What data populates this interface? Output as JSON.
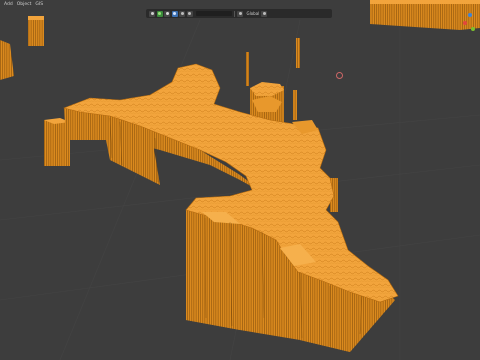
{
  "menu": [
    "Add",
    "Object",
    "GIS"
  ],
  "toolbar": {
    "mode_label": "Global",
    "search_placeholder": ""
  },
  "colors": {
    "background": "#3d3d3d",
    "mesh_top": "#f0a03a",
    "mesh_side": "#d88418",
    "mesh_dark": "#7a4708",
    "grid": "#4a4a4a",
    "gizmo_x": "#e2483c",
    "gizmo_y": "#7bbf2e",
    "gizmo_z": "#3d84d8"
  },
  "icons": [
    "cursor-icon",
    "orientation-icon",
    "pivot-icon",
    "snap-icon",
    "magnet-icon",
    "overlay-icon",
    "filter-icon",
    "dropdown-icon"
  ]
}
